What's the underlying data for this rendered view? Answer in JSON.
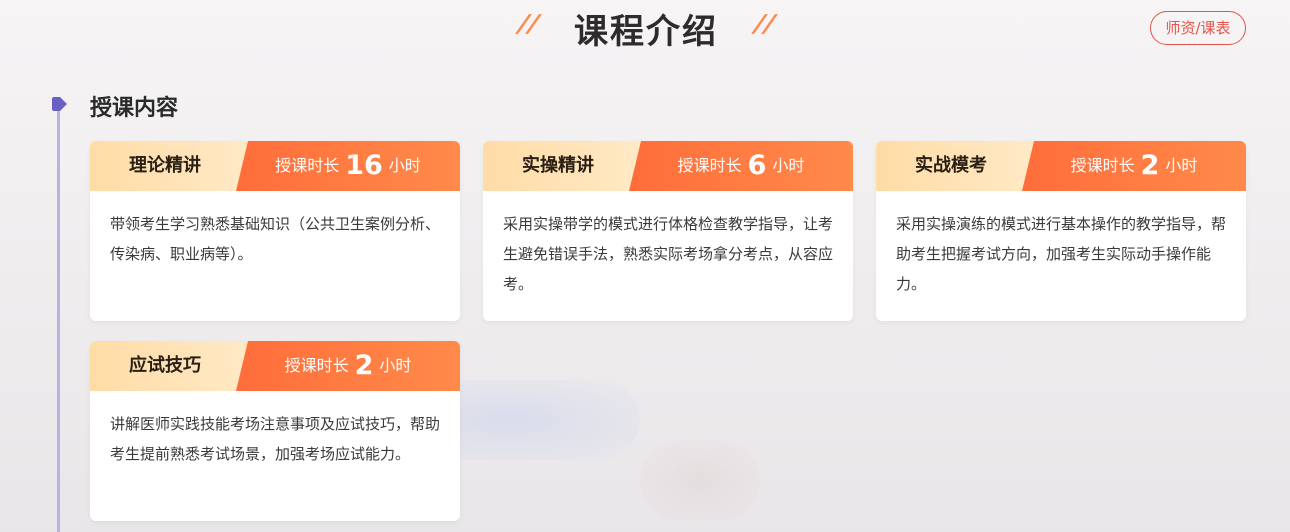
{
  "header": {
    "title": "课程介绍",
    "tab_button": "师资/课表"
  },
  "section": {
    "title": "授课内容"
  },
  "colors": {
    "accent_orange": "#ff7a42",
    "head_light": "#ffdca6",
    "timeline": "#b9b2e0",
    "tab_red": "#e4544a"
  },
  "courses": [
    {
      "name": "理论精讲",
      "duration_label": "授课时长",
      "hours": "16",
      "unit": "小时",
      "description": "带领考生学习熟悉基础知识（公共卫生案例分析、传染病、职业病等）。"
    },
    {
      "name": "实操精讲",
      "duration_label": "授课时长",
      "hours": "6",
      "unit": "小时",
      "description": "采用实操带学的模式进行体格检查教学指导，让考生避免错误手法，熟悉实际考场拿分考点，从容应考。"
    },
    {
      "name": "实战模考",
      "duration_label": "授课时长",
      "hours": "2",
      "unit": "小时",
      "description": "采用实操演练的模式进行基本操作的教学指导，帮助考生把握考试方向，加强考生实际动手操作能力。"
    },
    {
      "name": "应试技巧",
      "duration_label": "授课时长",
      "hours": "2",
      "unit": "小时",
      "description": "讲解医师实践技能考场注意事项及应试技巧，帮助考生提前熟悉考试场景，加强考场应试能力。"
    }
  ]
}
